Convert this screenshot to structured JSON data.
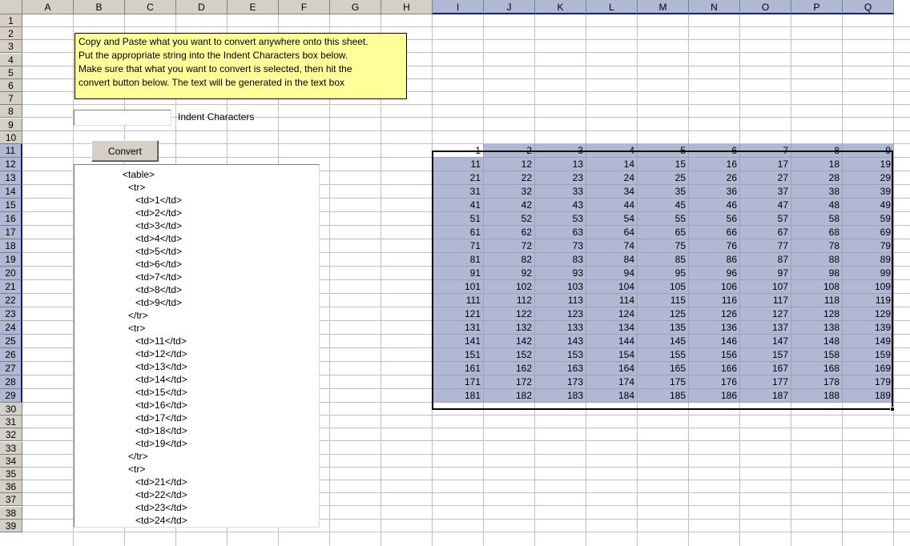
{
  "columns": [
    "A",
    "B",
    "C",
    "D",
    "E",
    "F",
    "G",
    "H",
    "I",
    "J",
    "K",
    "L",
    "M",
    "N",
    "O",
    "P",
    "Q"
  ],
  "selected_columns": [
    "I",
    "J",
    "K",
    "L",
    "M",
    "N",
    "O",
    "P",
    "Q"
  ],
  "selected_rows": [
    11,
    12,
    13,
    14,
    15,
    16,
    17,
    18,
    19,
    20,
    21,
    22,
    23,
    24,
    25,
    26,
    27,
    28,
    29
  ],
  "rows_visible": [
    1,
    2,
    3,
    4,
    5,
    6,
    7,
    8,
    9,
    10,
    11,
    12,
    13,
    14,
    15,
    16,
    17,
    18,
    19,
    20,
    21,
    22,
    23,
    24,
    25,
    26,
    27,
    28,
    29,
    30,
    31,
    32,
    33,
    34,
    35,
    36,
    37,
    38,
    39
  ],
  "instructions": {
    "line1": "Copy and Paste what you want to convert anywhere onto this sheet.",
    "line2": "Put the appropriate string into the Indent Characters box below.",
    "line3": "Make sure that what you want to convert is selected, then hit the",
    "line4": "convert button below.  The text will be generated in the text box"
  },
  "indent": {
    "value": "",
    "label": "Indent Characters"
  },
  "convert_button": {
    "label": "Convert"
  },
  "output_lines": [
    {
      "level": 0,
      "text": "<table>"
    },
    {
      "level": 1,
      "text": "<tr>"
    },
    {
      "level": 2,
      "text": "<td>1</td>"
    },
    {
      "level": 2,
      "text": "<td>2</td>"
    },
    {
      "level": 2,
      "text": "<td>3</td>"
    },
    {
      "level": 2,
      "text": "<td>4</td>"
    },
    {
      "level": 2,
      "text": "<td>5</td>"
    },
    {
      "level": 2,
      "text": "<td>6</td>"
    },
    {
      "level": 2,
      "text": "<td>7</td>"
    },
    {
      "level": 2,
      "text": "<td>8</td>"
    },
    {
      "level": 2,
      "text": "<td>9</td>"
    },
    {
      "level": 1,
      "text": "</tr>"
    },
    {
      "level": 1,
      "text": "<tr>"
    },
    {
      "level": 2,
      "text": "<td>11</td>"
    },
    {
      "level": 2,
      "text": "<td>12</td>"
    },
    {
      "level": 2,
      "text": "<td>13</td>"
    },
    {
      "level": 2,
      "text": "<td>14</td>"
    },
    {
      "level": 2,
      "text": "<td>15</td>"
    },
    {
      "level": 2,
      "text": "<td>16</td>"
    },
    {
      "level": 2,
      "text": "<td>17</td>"
    },
    {
      "level": 2,
      "text": "<td>18</td>"
    },
    {
      "level": 2,
      "text": "<td>19</td>"
    },
    {
      "level": 1,
      "text": "</tr>"
    },
    {
      "level": 1,
      "text": "<tr>"
    },
    {
      "level": 2,
      "text": "<td>21</td>"
    },
    {
      "level": 2,
      "text": "<td>22</td>"
    },
    {
      "level": 2,
      "text": "<td>23</td>"
    },
    {
      "level": 2,
      "text": "<td>24</td>"
    }
  ],
  "data_grid": {
    "rows": [
      [
        1,
        2,
        3,
        4,
        5,
        6,
        7,
        8,
        9
      ],
      [
        11,
        12,
        13,
        14,
        15,
        16,
        17,
        18,
        19
      ],
      [
        21,
        22,
        23,
        24,
        25,
        26,
        27,
        28,
        29
      ],
      [
        31,
        32,
        33,
        34,
        35,
        36,
        37,
        38,
        39
      ],
      [
        41,
        42,
        43,
        44,
        45,
        46,
        47,
        48,
        49
      ],
      [
        51,
        52,
        53,
        54,
        55,
        56,
        57,
        58,
        59
      ],
      [
        61,
        62,
        63,
        64,
        65,
        66,
        67,
        68,
        69
      ],
      [
        71,
        72,
        73,
        74,
        75,
        76,
        77,
        78,
        79
      ],
      [
        81,
        82,
        83,
        84,
        85,
        86,
        87,
        88,
        89
      ],
      [
        91,
        92,
        93,
        94,
        95,
        96,
        97,
        98,
        99
      ],
      [
        101,
        102,
        103,
        104,
        105,
        106,
        107,
        108,
        109
      ],
      [
        111,
        112,
        113,
        114,
        115,
        116,
        117,
        118,
        119
      ],
      [
        121,
        122,
        123,
        124,
        125,
        126,
        127,
        128,
        129
      ],
      [
        131,
        132,
        133,
        134,
        135,
        136,
        137,
        138,
        139
      ],
      [
        141,
        142,
        143,
        144,
        145,
        146,
        147,
        148,
        149
      ],
      [
        151,
        152,
        153,
        154,
        155,
        156,
        157,
        158,
        159
      ],
      [
        161,
        162,
        163,
        164,
        165,
        166,
        167,
        168,
        169
      ],
      [
        171,
        172,
        173,
        174,
        175,
        176,
        177,
        178,
        179
      ],
      [
        181,
        182,
        183,
        184,
        185,
        186,
        187,
        188,
        189
      ]
    ]
  },
  "colors": {
    "header_bg": "#d4d0c8",
    "selection": "#b0b8d4",
    "note_bg": "#ffff99",
    "gridline": "#c0c0c0"
  }
}
